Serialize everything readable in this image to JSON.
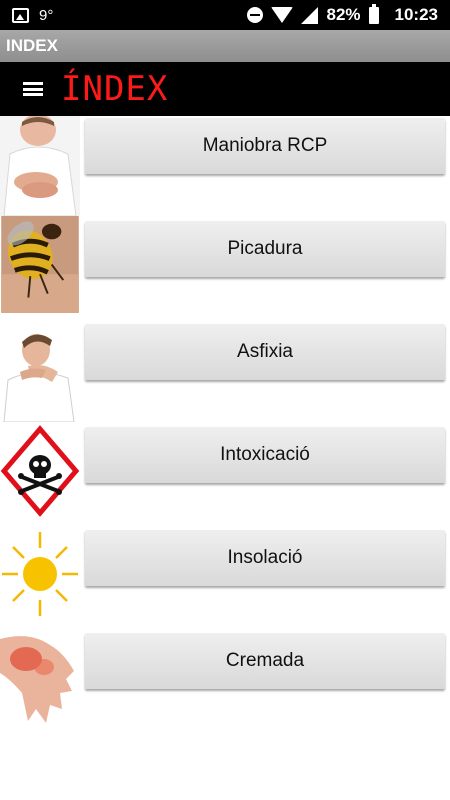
{
  "status_bar": {
    "temperature": "9°",
    "battery": "82%",
    "time": "10:23"
  },
  "title_bar": {
    "title": "INDEX"
  },
  "header": {
    "title": "ÍNDEX"
  },
  "menu": {
    "items": [
      {
        "label": "Maniobra RCP",
        "icon": "cpr-person-icon"
      },
      {
        "label": "Picadura",
        "icon": "wasp-icon"
      },
      {
        "label": "Asfixia",
        "icon": "choking-person-icon"
      },
      {
        "label": "Intoxicació",
        "icon": "toxic-hazard-icon"
      },
      {
        "label": "Insolació",
        "icon": "sun-icon"
      },
      {
        "label": "Cremada",
        "icon": "burned-hand-icon"
      }
    ]
  },
  "colors": {
    "status_bar_bg": "#000000",
    "title_bar_bg": "#9a9a9a",
    "header_bg": "#000000",
    "header_title": "#ff1a1a",
    "button_bg": "#e4e4e4"
  }
}
